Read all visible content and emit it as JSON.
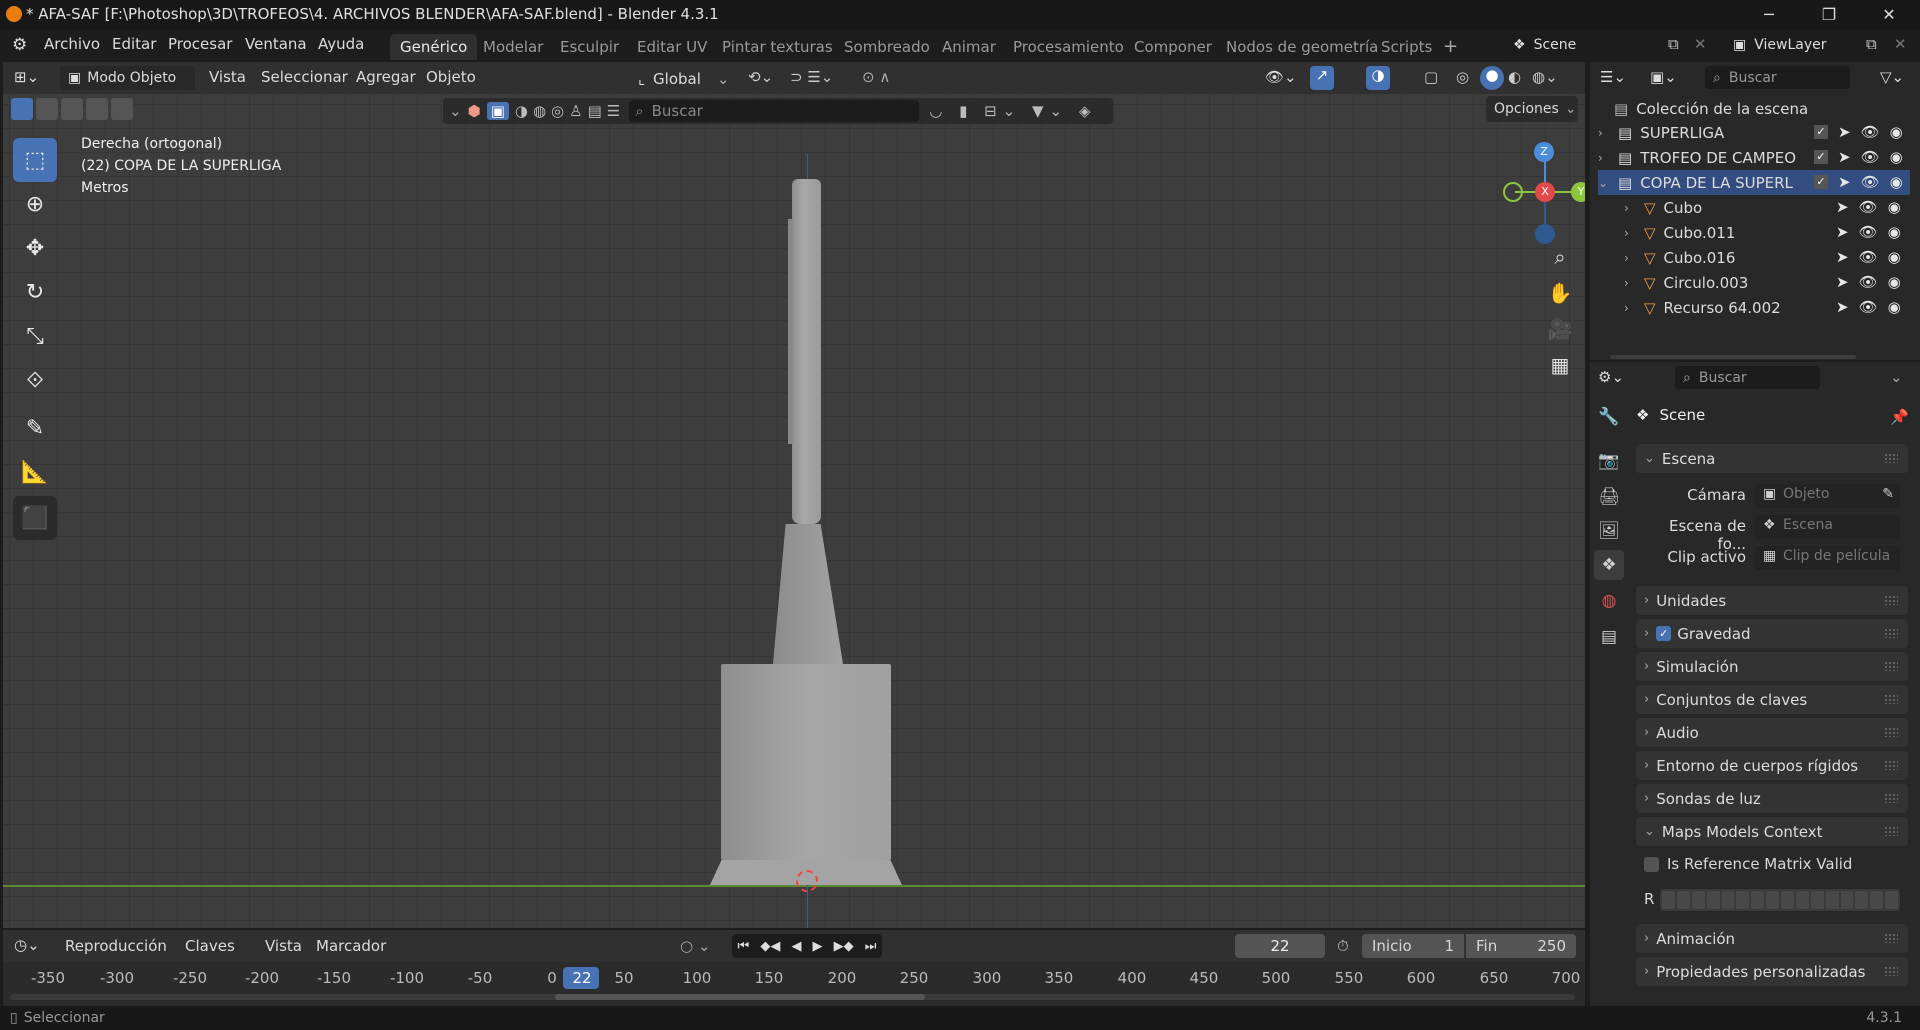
{
  "window": {
    "title": "* AFA-SAF [F:\\Photoshop\\3D\\TROFEOS\\4. ARCHIVOS BLENDER\\AFA-SAF.blend] - Blender 4.3.1"
  },
  "menu": [
    "Archivo",
    "Editar",
    "Procesar",
    "Ventana",
    "Ayuda"
  ],
  "workspaces": [
    "Genérico",
    "Modelar",
    "Esculpir",
    "Editar UV",
    "Pintar texturas",
    "Sombreado",
    "Animar",
    "Procesamiento",
    "Componer",
    "Nodos de geometría",
    "Scripts"
  ],
  "workspace_active": "Genérico",
  "scene_name": "Scene",
  "viewlayer_name": "ViewLayer",
  "viewport_header": {
    "mode": "Modo Objeto",
    "items": [
      "Vista",
      "Seleccionar",
      "Agregar",
      "Objeto"
    ],
    "orientation": "Global",
    "search_placeholder": "Buscar",
    "options": "Opciones"
  },
  "viewport_info": {
    "view": "Derecha (ortogonal)",
    "object": "(22) COPA DE LA SUPERLIGA",
    "units": "Metros"
  },
  "gizmo": {
    "z": "Z",
    "x": "X",
    "y": "Y"
  },
  "outliner": {
    "search_placeholder": "Buscar",
    "root": "Colección de la escena",
    "rows": [
      {
        "label": "SUPERLIGA",
        "type": "collection"
      },
      {
        "label": "TROFEO DE CAMPEO",
        "type": "collection"
      },
      {
        "label": "COPA DE LA SUPERL",
        "type": "collection"
      },
      {
        "label": "Cubo",
        "type": "object"
      },
      {
        "label": "Cubo.011",
        "type": "object"
      },
      {
        "label": "Cubo.016",
        "type": "object"
      },
      {
        "label": "Circulo.003",
        "type": "object"
      },
      {
        "label": "Recurso 64.002",
        "type": "object"
      }
    ]
  },
  "properties": {
    "search_placeholder": "Buscar",
    "context": "Scene",
    "scene_panel": "Escena",
    "fields": [
      {
        "label": "Cámara",
        "placeholder": "Objeto"
      },
      {
        "label": "Escena de fo...",
        "placeholder": "Escena"
      },
      {
        "label": "Clip activo",
        "placeholder": "Clip de película"
      }
    ],
    "panels": [
      "Unidades",
      "Gravedad",
      "Simulación",
      "Conjuntos de claves",
      "Audio",
      "Entorno de cuerpos rígidos",
      "Sondas de luz",
      "Maps Models Context"
    ],
    "maps_checkbox": "Is Reference Matrix Valid",
    "maps_r": "R",
    "panels2": [
      "Animación",
      "Propiedades personalizadas"
    ]
  },
  "timeline": {
    "menus": [
      "Reproducción",
      "Claves",
      "Vista",
      "Marcador"
    ],
    "current_frame": "22",
    "start_label": "Inicio",
    "start": "1",
    "end_label": "Fin",
    "end": "250",
    "ticks": [
      "-350",
      "-300",
      "-250",
      "-200",
      "-150",
      "-100",
      "-50",
      "0",
      "22",
      "50",
      "100",
      "150",
      "200",
      "250",
      "300",
      "350",
      "400",
      "450",
      "500",
      "550",
      "600",
      "650",
      "700"
    ]
  },
  "status": {
    "left": "Seleccionar",
    "version": "4.3.1"
  },
  "colors": {
    "accent": "#4772b3",
    "axis_x": "#e24a4a",
    "axis_y": "#8cc63f",
    "axis_z": "#4a8ddb"
  }
}
